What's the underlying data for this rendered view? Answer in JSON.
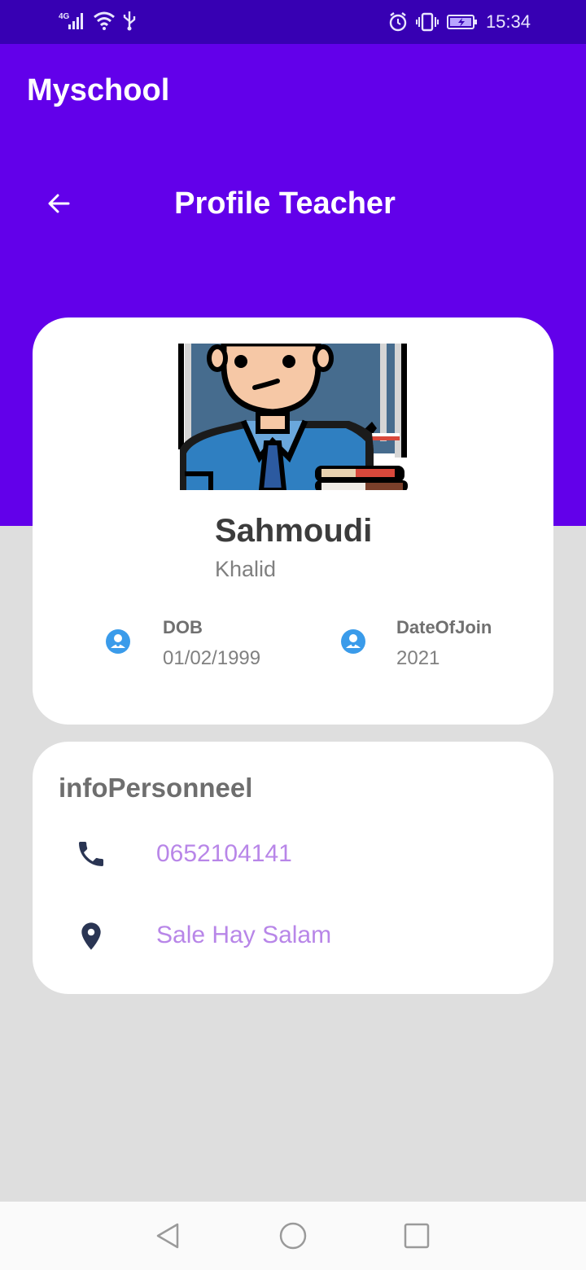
{
  "status_bar": {
    "network": "4G",
    "time": "15:34"
  },
  "app_bar": {
    "title": "Myschool"
  },
  "header": {
    "title": "Profile Teacher"
  },
  "profile": {
    "last_name": "Sahmoudi",
    "first_name": "Khalid",
    "dob_label": "DOB",
    "dob_value": "01/02/1999",
    "join_label": "DateOfJoin",
    "join_value": "2021"
  },
  "personal": {
    "title": "infoPersonneel",
    "phone": "0652104141",
    "address": "Sale Hay Salam"
  },
  "colors": {
    "status_bar": "#3700b3",
    "primary": "#6200ea",
    "link_text": "#b886e8",
    "background": "#dedede"
  }
}
